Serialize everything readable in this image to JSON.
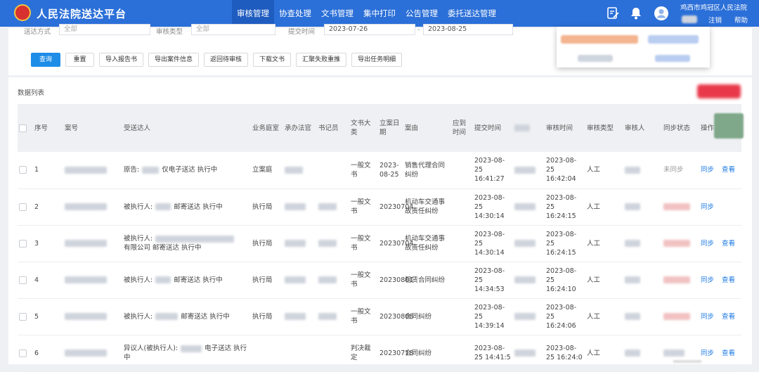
{
  "header": {
    "app_title": "人民法院送达平台",
    "nav": [
      "审核管理",
      "协查处理",
      "文书管理",
      "集中打印",
      "公告管理",
      "委托送达管理"
    ],
    "org_name": "鸡西市鸡冠区人民法院",
    "logout": "注销",
    "help": "帮助"
  },
  "filters": {
    "delivery_method_label": "送达方式",
    "delivery_method_value": "全部",
    "review_type_label": "审核类型",
    "review_type_value": "全部",
    "submit_time_label": "提交时间",
    "date_start": "2023-07-26",
    "date_sep": "-",
    "date_end": "2023-08-25"
  },
  "buttons": {
    "query": "查询",
    "reset": "重置",
    "import_report": "导入报告书",
    "export_case_info": "导出案件信息",
    "return_review": "返回待审核",
    "download_doc": "下载文书",
    "aggregate_fail": "汇聚失败重推",
    "export_task": "导出任务明细"
  },
  "list": {
    "title": "数据列表",
    "columns": {
      "seq": "序号",
      "case_no": "案号",
      "recipient": "受送达人",
      "dept": "业务庭室",
      "judge": "承办法官",
      "clerk": "书记员",
      "doc_category": "文书大类",
      "filing_date": "立案日期",
      "cause": "案由",
      "should_time": "应到时间",
      "submit_time": "提交时间",
      "review_time": "审核时间",
      "review_type": "审核类型",
      "reviewer": "审核人",
      "sync_status": "同步状态",
      "ops": "操作"
    },
    "rows": [
      {
        "seq": "1",
        "recipient": "原告:",
        "recipient_tail": "仅电子送达  执行中",
        "dept": "立案庭",
        "doc": "一般文书",
        "date": "2023-08-25",
        "cause": "销售代理合同纠纷",
        "submit": "2023-08-25 16:41:27",
        "review": "2023-08-25 16:42:04",
        "type": "人工",
        "sync": "未同步",
        "op1": "同步",
        "op2": "查看"
      },
      {
        "seq": "2",
        "recipient": "被执行人:",
        "recipient_tail": "邮寄送达  执行中",
        "dept": "执行局",
        "doc": "一般文书",
        "date": "20230704",
        "cause": "机动车交通事故责任纠纷",
        "submit": "2023-08-25 14:30:14",
        "review": "2023-08-25 16:24:15",
        "type": "人工",
        "sync": "",
        "op1": "同步",
        "op2": ""
      },
      {
        "seq": "3",
        "recipient": "被执行人:",
        "recipient_tail": "有限公司  邮寄送达  执行中",
        "dept": "执行局",
        "doc": "一般文书",
        "date": "20230704",
        "cause": "机动车交通事故责任纠纷",
        "submit": "2023-08-25 14:30:14",
        "review": "2023-08-25 16:24:15",
        "type": "人工",
        "sync": "",
        "op1": "同步",
        "op2": "查看"
      },
      {
        "seq": "4",
        "recipient": "被执行人:",
        "recipient_tail": "邮寄送达  执行中",
        "dept": "执行局",
        "doc": "一般文书",
        "date": "20230801",
        "cause": "租赁合同纠纷",
        "submit": "2023-08-25 14:34:53",
        "review": "2023-08-25 16:24:10",
        "type": "人工",
        "sync": "",
        "op1": "同步",
        "op2": "查看"
      },
      {
        "seq": "5",
        "recipient": "被执行人:",
        "recipient_tail": "邮寄送达  执行中",
        "dept": "执行局",
        "doc": "一般文书",
        "date": "20230808",
        "cause": "合同纠纷",
        "submit": "2023-08-25 14:39:14",
        "review": "2023-08-25 16:24:06",
        "type": "人工",
        "sync": "",
        "op1": "同步",
        "op2": "查看"
      },
      {
        "seq": "6",
        "recipient": "异议人(被执行人):",
        "recipient_tail": "电子送达  执行中",
        "dept": "",
        "doc": "判决裁定",
        "date": "20230718",
        "cause": "合同纠纷",
        "submit": "2023-08-25 14:41:5",
        "review": "2023-08-25 16:24:0",
        "type": "人工",
        "sync": "",
        "op1": "同步",
        "op2": "查看"
      }
    ]
  },
  "colors": {
    "header": "#2b6fd8",
    "primary": "#1e8de8",
    "link": "#1e7ae0"
  },
  "icons": [
    "court-emblem-icon",
    "edit-doc-icon",
    "bell-icon",
    "user-avatar-icon"
  ]
}
